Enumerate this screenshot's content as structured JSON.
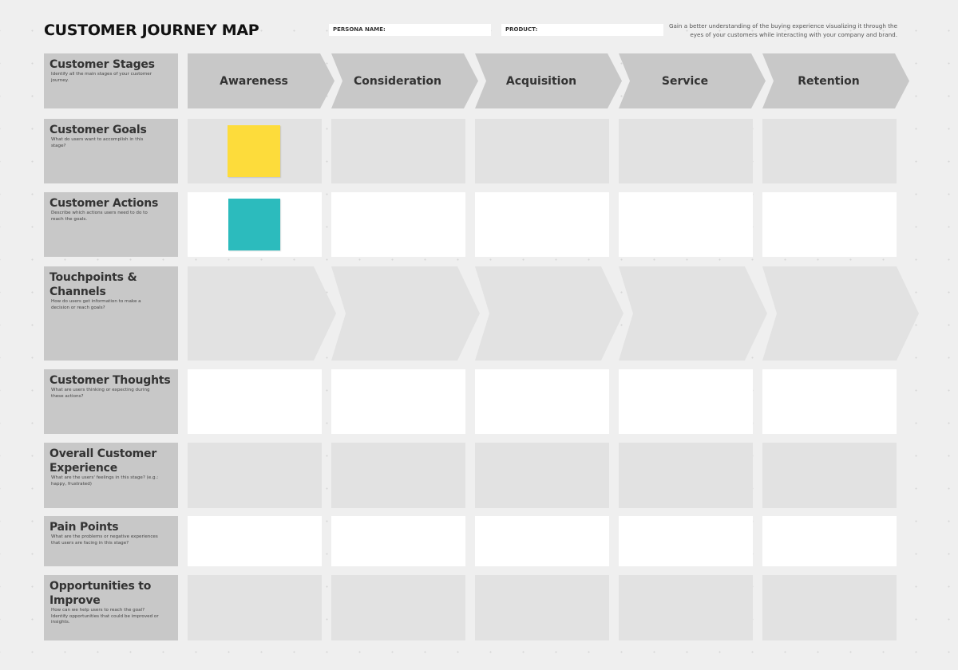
{
  "header": {
    "title": "CUSTOMER JOURNEY MAP",
    "persona_label": "PERSONA NAME:",
    "persona_value": "",
    "product_label": "PRODUCT:",
    "product_value": "",
    "intro": "Gain a better understanding of the buying experience visualizing it through the eyes of your customers while interacting with your company and brand."
  },
  "stages": [
    "Awareness",
    "Consideration",
    "Acquisition",
    "Service",
    "Retention"
  ],
  "rows": [
    {
      "title": "Customer Stages",
      "desc": "Identify all the main stages of your customer journey.",
      "cell_style": "chevron-dark"
    },
    {
      "title": "Customer Goals",
      "desc": "What do users want to accomplish in this stage?",
      "cell_style": "grey"
    },
    {
      "title": "Customer Actions",
      "desc": "Describe which actions users need to do to reach the goals.",
      "cell_style": "white"
    },
    {
      "title": "Touchpoints & Channels",
      "desc": "How do users get information to make a decision or reach goals?",
      "cell_style": "chevron-light"
    },
    {
      "title": "Customer Thoughts",
      "desc": "What are users thinking or expecting during these actions?",
      "cell_style": "white"
    },
    {
      "title": "Overall Customer Experience",
      "desc": "What are the users' feelings in this stage? (e.g.: happy, frustrated)",
      "cell_style": "grey"
    },
    {
      "title": "Pain Points",
      "desc": "What are the problems or negative experiences that users are facing in this stage?",
      "cell_style": "white"
    },
    {
      "title": "Opportunities to Improve",
      "desc": "How can we help users to reach the goal? Identify opportunities that could be improved or insights.",
      "cell_style": "grey"
    }
  ],
  "sticky_notes": [
    {
      "color": "#fddc3b",
      "row": "Customer Goals",
      "stage": "Awareness",
      "text": ""
    },
    {
      "color": "#2cbbbd",
      "row": "Customer Actions",
      "stage": "Awareness",
      "text": ""
    }
  ],
  "colors": {
    "background": "#efefef",
    "label_card": "#c8c8c8",
    "chevron_dark": "#c8c8c8",
    "chevron_light": "#e2e2e2",
    "cell_grey": "#e2e2e2",
    "cell_white": "#ffffff"
  }
}
